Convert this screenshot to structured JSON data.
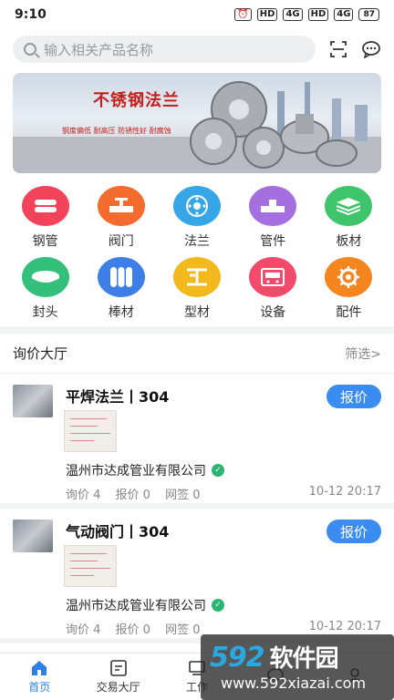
{
  "status": {
    "time": "9:10",
    "hd1": "HD",
    "net1": "4G",
    "hd2": "HD",
    "net2": "4G",
    "battery": "87"
  },
  "search": {
    "placeholder": "输入相关产品名称"
  },
  "banner": {
    "title": "不锈钢法兰",
    "features": "钢度偏低 耐高压 防锈性好 耐腐蚀"
  },
  "categories": [
    {
      "label": "钢管",
      "color": "#f2435b",
      "icon": "pipe-icon"
    },
    {
      "label": "阀门",
      "color": "#f36b2d",
      "icon": "valve-icon"
    },
    {
      "label": "法兰",
      "color": "#36a6e6",
      "icon": "flange-icon"
    },
    {
      "label": "管件",
      "color": "#a66fe0",
      "icon": "fitting-icon"
    },
    {
      "label": "板材",
      "color": "#3ec46a",
      "icon": "plate-icon"
    },
    {
      "label": "封头",
      "color": "#33c07a",
      "icon": "head-icon"
    },
    {
      "label": "棒材",
      "color": "#3d7fe6",
      "icon": "bar-icon"
    },
    {
      "label": "型材",
      "color": "#f2b81c",
      "icon": "profile-icon"
    },
    {
      "label": "设备",
      "color": "#f24a6a",
      "icon": "equipment-icon"
    },
    {
      "label": "配件",
      "color": "#f5861f",
      "icon": "gear-icon"
    }
  ],
  "inquiry": {
    "title": "询价大厅",
    "filter": "筛选>"
  },
  "cards": [
    {
      "title": "平焊法兰丨304",
      "button": "报价",
      "company": "温州市达成管业有限公司",
      "inquiry": "询价 4",
      "quotes": "报价 0",
      "sign": "网签 0",
      "date": "10-12 20:17"
    },
    {
      "title": "气动阀门丨304",
      "button": "报价",
      "company": "温州市达成管业有限公司",
      "inquiry": "询价 4",
      "quotes": "报价 0",
      "sign": "网签 0",
      "date": "10-12 20:17"
    }
  ],
  "tabs": [
    {
      "label": "首页",
      "icon": "home-icon"
    },
    {
      "label": "交易大厅",
      "icon": "trade-icon"
    },
    {
      "label": "工作",
      "icon": "work-icon"
    },
    {
      "label": "",
      "icon": "message-icon"
    },
    {
      "label": "",
      "icon": "profile-icon"
    }
  ],
  "watermark": {
    "logo": "592",
    "logo_text": "软件园",
    "url": "www.592xiazai.com"
  }
}
